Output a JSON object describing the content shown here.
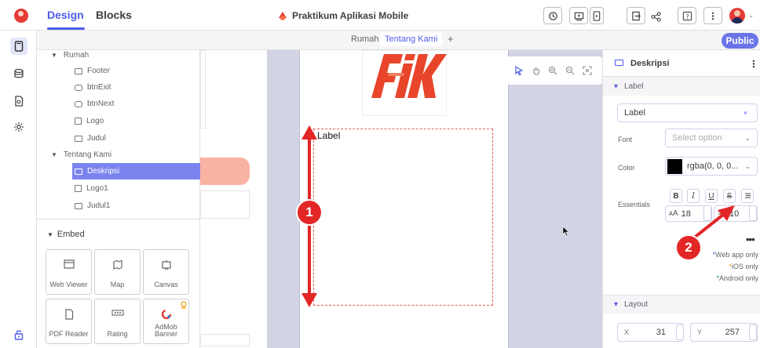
{
  "topbar": {
    "tabs": [
      "Design",
      "Blocks"
    ],
    "project_title": "Praktikum Aplikasi Mobile"
  },
  "screen_tabs": {
    "items": [
      "Rumah",
      "Tentang Kami"
    ],
    "active": "Tentang Kami",
    "add": "+"
  },
  "public_label": "Public",
  "tree": {
    "rumah": {
      "label": "Rumah",
      "children": [
        "Footer",
        "btnExit",
        "btnNext",
        "Logo",
        "Judul"
      ]
    },
    "tentang": {
      "label": "Tentang Kami",
      "children": [
        "Deskripsi",
        "Logo1",
        "Judul1"
      ]
    }
  },
  "embed": {
    "title": "Embed",
    "tiles": [
      "Web Viewer",
      "Map",
      "Canvas",
      "PDF Reader",
      "Rating",
      "AdMob Banner"
    ]
  },
  "canvas": {
    "brand_text": "FIK",
    "label_text": "Label"
  },
  "props": {
    "title": "Deskripsi",
    "label_section": "Label",
    "label_value": "Label",
    "font_label": "Font",
    "font_placeholder": "Select option",
    "color_label": "Color",
    "color_value": "rgba(0, 0, 0...",
    "color_swatch": "#000000",
    "essentials_label": "Essentials",
    "font_size": "18",
    "line_height": "10",
    "legend": [
      "Web app only",
      "iOS only",
      "Android only"
    ],
    "layout_section": "Layout",
    "x_label": "X",
    "x_value": "31",
    "y_label": "Y",
    "y_value": "257"
  },
  "annotations": {
    "badge1": "1",
    "badge2": "2"
  },
  "colors": {
    "accent": "#4e5ce8",
    "annotation_red": "#e32626",
    "selection": "#7b84ee"
  }
}
